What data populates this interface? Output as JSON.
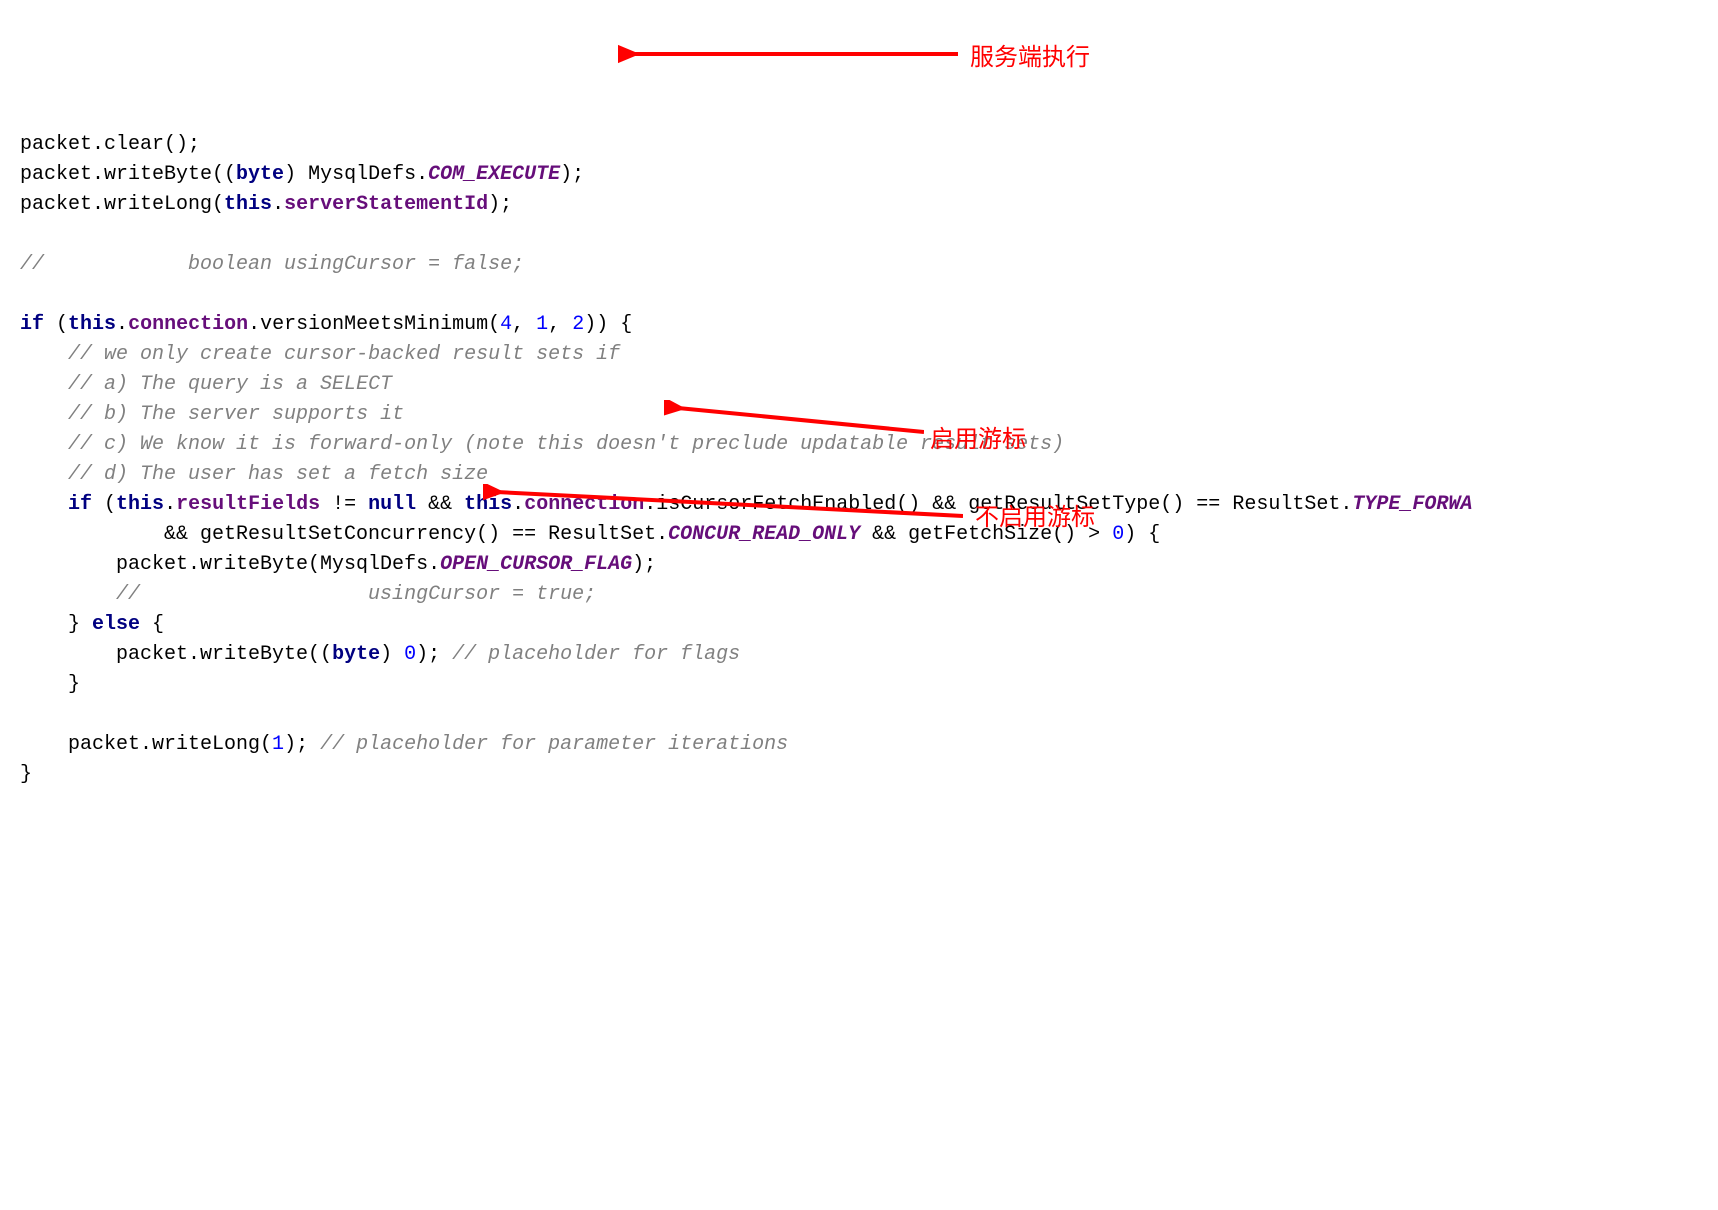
{
  "code": {
    "l1_a": "packet.clear();",
    "l2_a": "packet.writeByte((",
    "l2_b": "byte",
    "l2_c": ") MysqlDefs.",
    "l2_d": "COM_EXECUTE",
    "l2_e": ");",
    "l3_a": "packet.writeLong(",
    "l3_b": "this",
    "l3_c": ".",
    "l3_d": "serverStatementId",
    "l3_e": ");",
    "l5_a": "//            boolean usingCursor = false;",
    "l7_a": "if",
    "l7_b": " (",
    "l7_c": "this",
    "l7_d": ".",
    "l7_e": "connection",
    "l7_f": ".versionMeetsMinimum(",
    "l7_g": "4",
    "l7_h": ", ",
    "l7_i": "1",
    "l7_j": ", ",
    "l7_k": "2",
    "l7_l": ")) {",
    "l8_a": "    ",
    "l8_b": "// we only create cursor-backed result sets if",
    "l9_a": "    ",
    "l9_b": "// a) The query is a SELECT",
    "l10_a": "    ",
    "l10_b": "// b) The server supports it",
    "l11_a": "    ",
    "l11_b": "// c) We know it is forward-only (note this doesn't preclude updatable result sets)",
    "l12_a": "    ",
    "l12_b": "// d) The user has set a fetch size",
    "l13_a": "    ",
    "l13_b": "if",
    "l13_c": " (",
    "l13_d": "this",
    "l13_e": ".",
    "l13_f": "resultFields",
    "l13_g": " != ",
    "l13_h": "null",
    "l13_i": " && ",
    "l13_j": "this",
    "l13_k": ".",
    "l13_l": "connection",
    "l13_m": ".isCursorFetchEnabled() && getResultSetType() == ResultSet.",
    "l13_n": "TYPE_FORWA",
    "l14_a": "            && getResultSetConcurrency() == ResultSet.",
    "l14_b": "CONCUR_READ_ONLY",
    "l14_c": " && getFetchSize() > ",
    "l14_d": "0",
    "l14_e": ") {",
    "l15_a": "        packet.writeByte(MysqlDefs.",
    "l15_b": "OPEN_CURSOR_FLAG",
    "l15_c": ");",
    "l16_a": "        ",
    "l16_b": "//                   usingCursor = true;",
    "l17_a": "    } ",
    "l17_b": "else",
    "l17_c": " {",
    "l18_a": "        packet.writeByte((",
    "l18_b": "byte",
    "l18_c": ") ",
    "l18_d": "0",
    "l18_e": "); ",
    "l18_f": "// placeholder for flags",
    "l19_a": "    }",
    "l21_a": "    packet.writeLong(",
    "l21_b": "1",
    "l21_c": "); ",
    "l21_d": "// placeholder for parameter iterations",
    "l22_a": "}"
  },
  "annotations": {
    "a1": "服务端执行",
    "a2": "启用游标",
    "a3": "不启用游标"
  }
}
